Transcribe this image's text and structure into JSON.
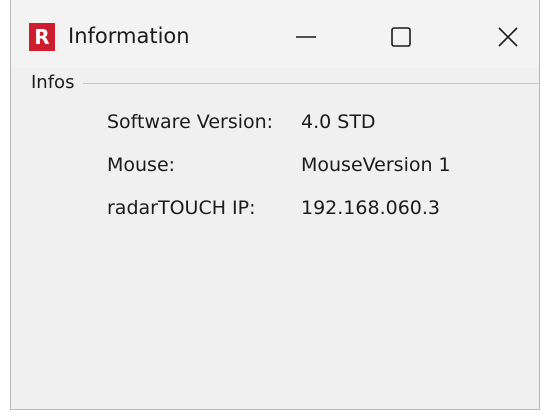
{
  "window": {
    "title": "Information",
    "app_icon_letter": "R",
    "app_icon_color": "#cc1e2c"
  },
  "group": {
    "label": "Infos"
  },
  "rows": [
    {
      "label": "Software Version:",
      "value": "4.0 STD"
    },
    {
      "label": "Mouse:",
      "value": "MouseVersion 1"
    },
    {
      "label": "radarTOUCH IP:",
      "value": "192.168.060.3"
    }
  ],
  "icons": {
    "minimize": "minimize-icon",
    "maximize": "maximize-icon",
    "close": "close-icon"
  }
}
